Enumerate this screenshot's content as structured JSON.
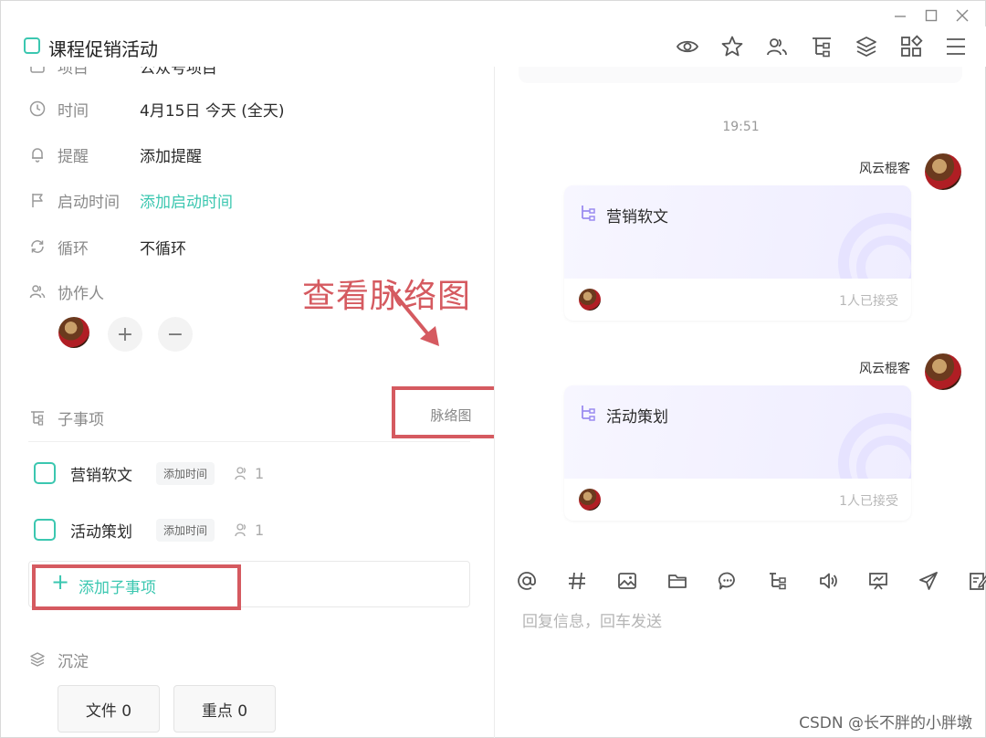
{
  "window": {
    "controls": [
      "minimize-icon",
      "maximize-icon",
      "close-icon"
    ]
  },
  "header": {
    "title": "课程促销活动",
    "toolbar_icons": [
      "eye-icon",
      "star-icon",
      "users-icon",
      "subtask-tree-icon",
      "layers-icon",
      "apps-grid-icon",
      "menu-icon"
    ]
  },
  "left": {
    "project_row": {
      "label": "项目",
      "value": "公众号项目"
    },
    "time_row": {
      "label": "时间",
      "value": "4月15日 今天 (全天)"
    },
    "reminder_row": {
      "label": "提醒",
      "value": "添加提醒"
    },
    "start_row": {
      "label": "启动时间",
      "value": "添加启动时间"
    },
    "repeat_row": {
      "label": "循环",
      "value": "不循环"
    },
    "collab_row": {
      "label": "协作人",
      "add": "+",
      "remove": "−"
    },
    "subtasks": {
      "label": "子事项",
      "mindmap_button": "脉络图",
      "items": [
        {
          "title": "营销软文",
          "time_tag": "添加时间",
          "count": "1"
        },
        {
          "title": "活动策划",
          "time_tag": "添加时间",
          "count": "1"
        }
      ],
      "add_label": "添加子事项"
    },
    "deposit": {
      "label": "沉淀",
      "files_button": "文件 0",
      "keypoints_button": "重点 0"
    },
    "annotation": "查看脉络图"
  },
  "right": {
    "timestamp": "19:51",
    "messages": [
      {
        "sender": "风云棍客",
        "card_title": "营销软文",
        "accepted": "1人已接受"
      },
      {
        "sender": "风云棍客",
        "card_title": "活动策划",
        "accepted": "1人已接受"
      }
    ],
    "toolbar_icons": [
      "at-icon",
      "hash-icon",
      "image-icon",
      "folder-icon",
      "chat-bubble-icon",
      "subtask-icon",
      "voice-icon",
      "presentation-icon",
      "send-icon",
      "edit-icon"
    ],
    "reply_placeholder": "回复信息，回车发送"
  },
  "watermark": "CSDN @长不胖的小胖墩",
  "colors": {
    "accent": "#3bc7b0",
    "annotation_red": "#d55a60"
  }
}
